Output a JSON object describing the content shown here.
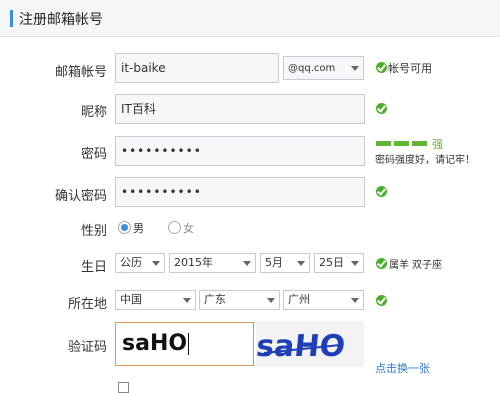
{
  "title": "注册邮箱帐号",
  "fields": {
    "email": {
      "label": "邮箱帐号",
      "value": "it-baike",
      "domain": "@qq.com",
      "status": "帐号可用"
    },
    "nickname": {
      "label": "昵称",
      "value": "IT百科"
    },
    "password": {
      "label": "密码",
      "value": "••••••••••",
      "strength_label": "强",
      "hint": "密码强度好，请记牢！"
    },
    "confirm": {
      "label": "确认密码",
      "value": "••••••••••"
    },
    "gender": {
      "label": "性别",
      "options": [
        "男",
        "女"
      ],
      "selected": "男"
    },
    "birthday": {
      "label": "生日",
      "calendar": "公历",
      "year": "2015年",
      "month": "5月",
      "day": "25日",
      "zodiac": "属羊",
      "constellation": "双子座"
    },
    "location": {
      "label": "所在地",
      "country": "中国",
      "province": "广东",
      "city": "广州"
    },
    "captcha": {
      "label": "验证码",
      "value": "saHO",
      "image_text": "saHO",
      "refresh": "点击换一张"
    }
  },
  "colors": {
    "accent": "#3a8ee6",
    "ok": "#4caf2b",
    "strength": "#5fb534",
    "captcha_border": "#d39b55",
    "link": "#2e7bd6"
  }
}
